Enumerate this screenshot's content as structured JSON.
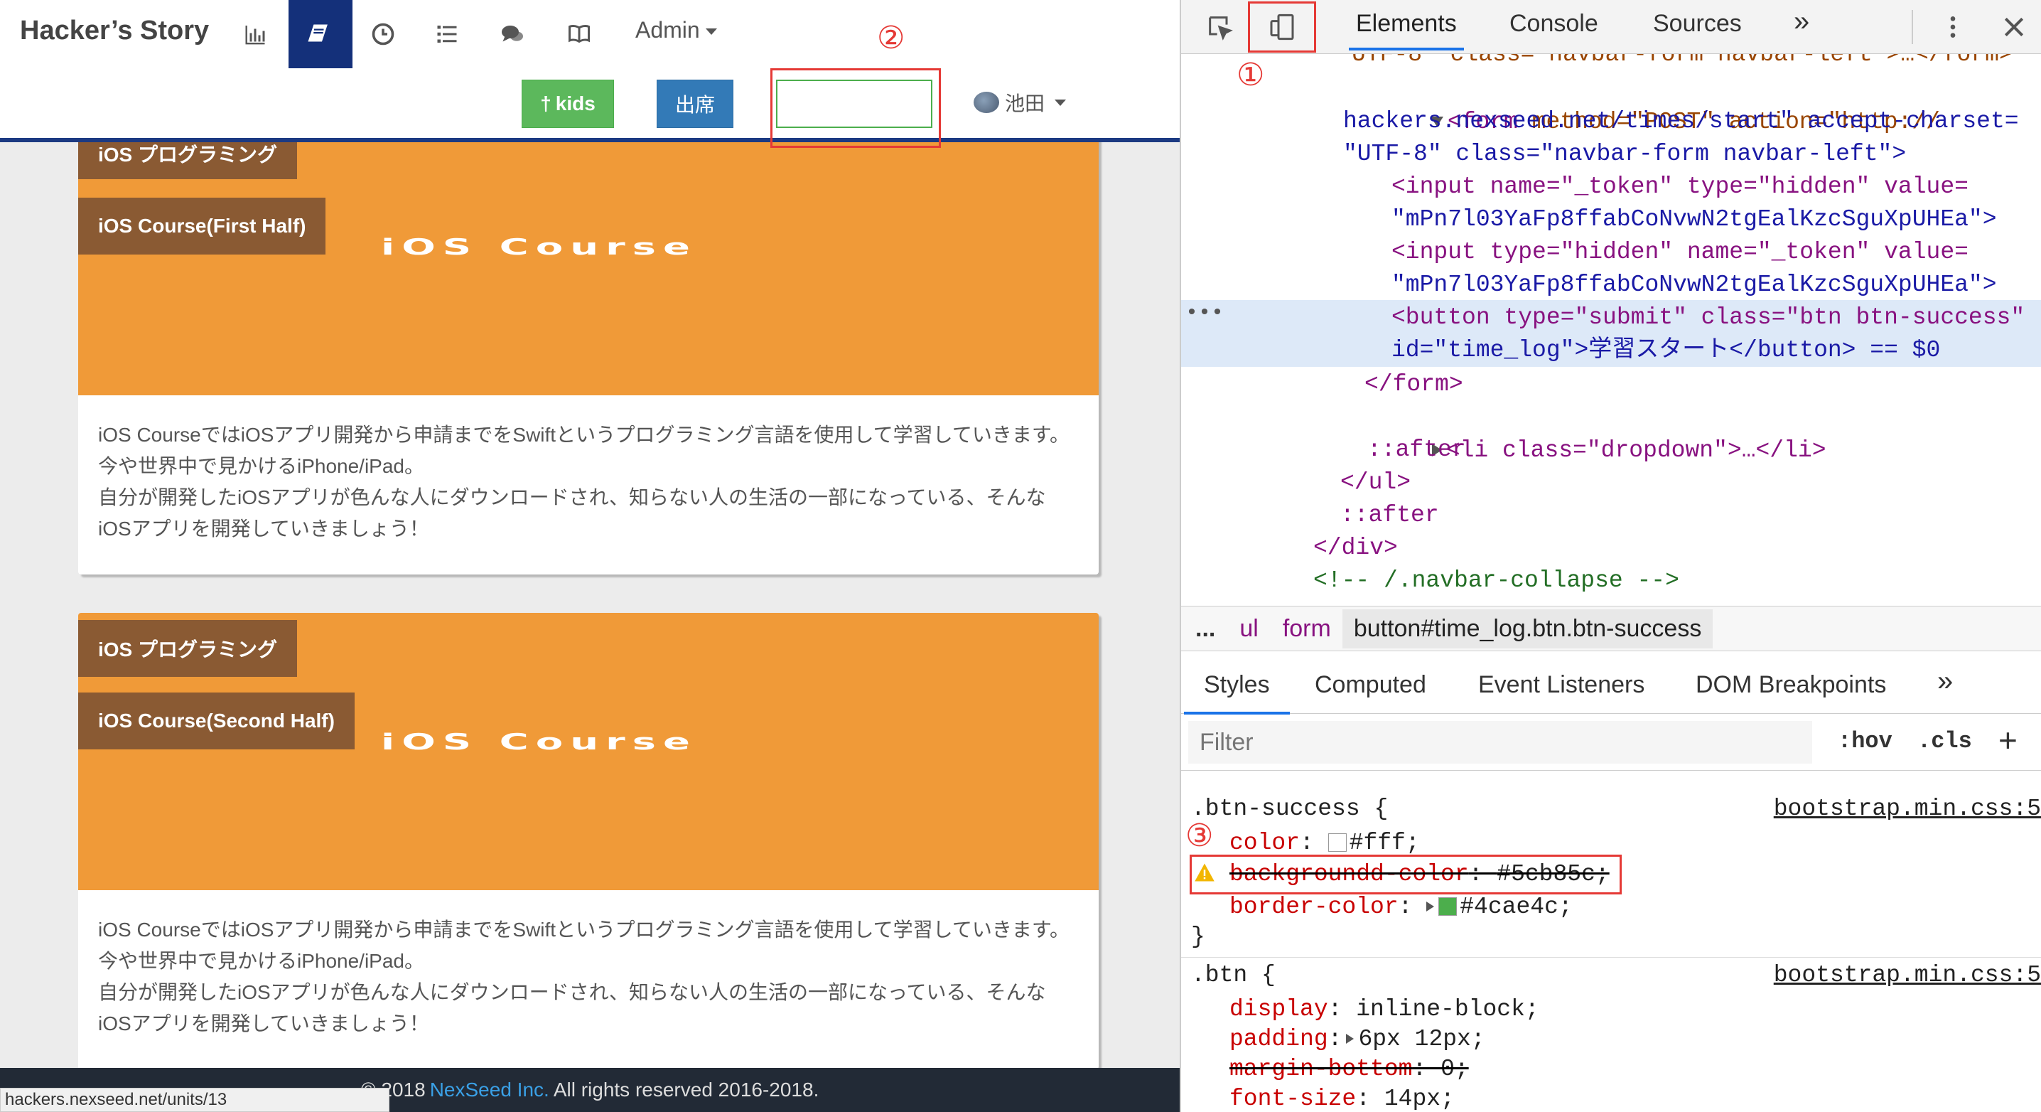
{
  "site": {
    "brand": "Hacker’s Story",
    "nav_icons": [
      "bar-chart-icon",
      "book-icon",
      "clock-icon",
      "list-icon",
      "comments-icon",
      "open-book-icon"
    ],
    "admin_label": "Admin",
    "kids_label": "kids",
    "attend_label": "出席",
    "user_name": "池田",
    "marker_2": "②",
    "cards": [
      {
        "tag_category": "iOS プログラミング",
        "tag_title": "iOS Course(First Half)",
        "hero_title": "iOS Course",
        "description": [
          "iOS CourseではiOSアプリ開発から申請までをSwiftというプログラミング言語を使用して学習していきます。",
          "今や世界中で見かけるiPhone/iPad。",
          "自分が開発したiOSアプリが色んな人にダウンロードされ、知らない人の生活の一部になっている、そんな",
          "iOSアプリを開発していきましょう！"
        ]
      },
      {
        "tag_category": "iOS プログラミング",
        "tag_title": "iOS Course(Second Half)",
        "hero_title": "iOS Course",
        "description": [
          "iOS CourseではiOSアプリ開発から申請までをSwiftというプログラミング言語を使用して学習していきます。",
          "今や世界中で見かけるiPhone/iPad。",
          "自分が開発したiOSアプリが色んな人にダウンロードされ、知らない人の生活の一部になっている、そんな",
          "iOSアプリを開発していきましょう！"
        ]
      }
    ],
    "footer": {
      "prefix": "© 2018",
      "link": "NexSeed Inc.",
      "suffix": "All rights reserved 2016-2018."
    },
    "status_url": "hackers.nexseed.net/units/13"
  },
  "devtools": {
    "marker_1": "①",
    "tabs": [
      "Elements",
      "Console",
      "Sources"
    ],
    "more_tabs": "»",
    "elements_lines": {
      "l0": "UTF-8\" class=\"navbar-form navbar-left\">…</form>",
      "l1_tag": "<form",
      "l1_attrs": " method=\"POST\" action=\"http://",
      "l2": "hackers.nexseed.net/times/start\" accept-charset=",
      "l3": "\"UTF-8\" class=\"navbar-form navbar-left\">",
      "l4": "<input name=\"_token\" type=\"hidden\" value=",
      "l5": "\"mPn7l03YaFp8ffabCoNvwN2tgEalKzcSguXpUHEa\">",
      "l6": "<input type=\"hidden\" name=\"_token\" value=",
      "l7": "\"mPn7l03YaFp8ffabCoNvwN2tgEalKzcSguXpUHEa\">",
      "l8": "<button type=\"submit\" class=\"btn btn-success\"",
      "l9": "id=\"time_log\">学習スタート</button> == $0",
      "l10": "</form>",
      "l11": "<li class=\"dropdown\">…</li>",
      "l12": "::after",
      "l13": "</ul>",
      "l14": "::after",
      "l15": "</div>",
      "l16": "<!-- /.navbar-collapse -->"
    },
    "breadcrumb": [
      "...",
      "ul",
      "form",
      "button#time_log.btn.btn-success"
    ],
    "style_tabs": [
      "Styles",
      "Computed",
      "Event Listeners",
      "DOM Breakpoints"
    ],
    "filter_placeholder": "Filter",
    "hov": ":hov",
    "cls": ".cls",
    "plus": "+",
    "marker_3": "③",
    "rules": {
      "btn_success": {
        "selector": ".btn-success {",
        "source": "bootstrap.min.css:5",
        "color_prop": "color",
        "color_val": "#fff;",
        "bg_prop": "backgroundd-color",
        "bg_val": "#5cb85c;",
        "border_prop": "border-color",
        "border_val": "#4cae4c;",
        "close": "}"
      },
      "btn": {
        "selector": ".btn {",
        "source": "bootstrap.min.css:5",
        "display_prop": "display",
        "display_val": "inline-block;",
        "padding_prop": "padding",
        "padding_val": "6px 12px;",
        "margin_prop": "margin-bottom",
        "margin_val": "0;",
        "font_prop": "font-size",
        "font_val": "14px;"
      }
    },
    "colors": {
      "swatch_white": "#ffffff",
      "swatch_green": "#4cae4c",
      "highlight_red": "#e53935"
    }
  }
}
